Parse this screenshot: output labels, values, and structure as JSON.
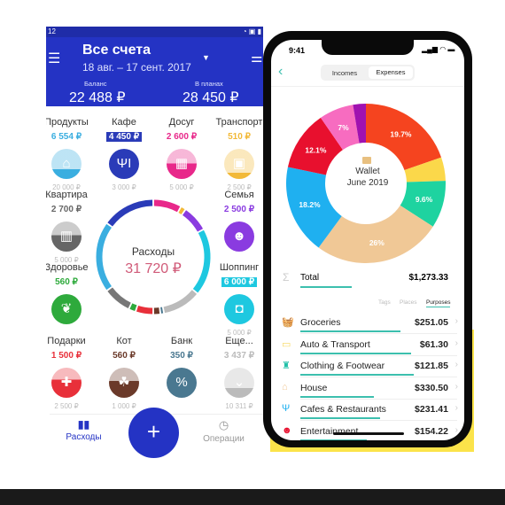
{
  "left_app": {
    "status_time": "12",
    "header": {
      "title": "Все счета",
      "period": "18 авг. – 17 сент. 2017",
      "balance_label": "Баланс",
      "balance": "22 488 ₽",
      "planned_label": "В планах",
      "planned": "28 450 ₽"
    },
    "categories": [
      {
        "label": "Продукты",
        "amount": "6 554 ₽",
        "limit": "20 000 ₽",
        "color": "#3aaee0",
        "icon": "basket-icon",
        "fill": 0.33
      },
      {
        "label": "Кафе",
        "amount": "4 450 ₽",
        "limit": "3 000 ₽",
        "color": "#2a3bb8",
        "icon": "fork-knife-icon",
        "fill": 1,
        "boxed": true
      },
      {
        "label": "Досуг",
        "amount": "2 600 ₽",
        "limit": "5 000 ₽",
        "color": "#e8288a",
        "icon": "film-icon",
        "fill": 0.52
      },
      {
        "label": "Транспорт",
        "amount": "510 ₽",
        "limit": "2 500 ₽",
        "color": "#f2b938",
        "icon": "bus-icon",
        "fill": 0.2
      },
      {
        "label": "Квартира",
        "amount": "2 700 ₽",
        "limit": "5 000 ₽",
        "color": "#666666",
        "icon": "building-icon",
        "fill": 0.54
      },
      {
        "label": "Семья",
        "amount": "2 500 ₽",
        "limit": "",
        "color": "#8a3be0",
        "icon": "face-icon",
        "fill": 1
      },
      {
        "label": "Здоровье",
        "amount": "560 ₽",
        "limit": "",
        "color": "#2eaa3c",
        "icon": "leaf-icon",
        "fill": 1
      },
      {
        "label": "Шоппинг",
        "amount": "6 000 ₽",
        "limit": "5 000 ₽",
        "color": "#1ec8e0",
        "icon": "bag-icon",
        "fill": 1,
        "boxed": true
      },
      {
        "label": "Подарки",
        "amount": "1 500 ₽",
        "limit": "2 500 ₽",
        "color": "#e8303a",
        "icon": "gift-icon",
        "fill": 0.6
      },
      {
        "label": "Кот",
        "amount": "560 ₽",
        "limit": "1 000 ₽",
        "color": "#6b3a2a",
        "icon": "paw-icon",
        "fill": 0.56
      },
      {
        "label": "Банк",
        "amount": "350 ₽",
        "limit": "",
        "color": "#4a7890",
        "icon": "percent-icon",
        "fill": 1
      },
      {
        "label": "Еще...",
        "amount": "3 437 ₽",
        "limit": "10 311 ₽",
        "color": "#bbbbbb",
        "icon": "chevron-down-icon",
        "fill": 0.33
      }
    ],
    "ring": {
      "label": "Расходы",
      "total": "31 720 ₽",
      "segments": [
        {
          "color": "#e8288a",
          "value": 8
        },
        {
          "color": "#f2b938",
          "value": 1.5
        },
        {
          "color": "#8a3be0",
          "value": 7.5
        },
        {
          "color": "#1ec8e0",
          "value": 19
        },
        {
          "color": "#bbbbbb",
          "value": 11
        },
        {
          "color": "#4a7890",
          "value": 1
        },
        {
          "color": "#6b3a2a",
          "value": 2
        },
        {
          "color": "#e8303a",
          "value": 5
        },
        {
          "color": "#2eaa3c",
          "value": 2
        },
        {
          "color": "#777777",
          "value": 8
        },
        {
          "color": "#3aaee0",
          "value": 20
        },
        {
          "color": "#2a3bb8",
          "value": 15
        }
      ]
    },
    "nav": {
      "expenses": "Расходы",
      "operations": "Операции",
      "add": "+"
    }
  },
  "right_app": {
    "status_time": "9:41",
    "tabs": [
      "Incomes",
      "Expenses"
    ],
    "active_tab": "Expenses",
    "center_title": "Wallet",
    "center_period": "June 2019",
    "donut": [
      {
        "label": "19.7%",
        "value": 19.7,
        "color": "#f5441f"
      },
      {
        "label": "",
        "value": 4.8,
        "color": "#fbd84a"
      },
      {
        "label": "9.6%",
        "value": 9.6,
        "color": "#1ed3a0"
      },
      {
        "label": "26%",
        "value": 26,
        "color": "#f0c896"
      },
      {
        "label": "18.2%",
        "value": 18.2,
        "color": "#1fb0f0"
      },
      {
        "label": "12.1%",
        "value": 12.1,
        "color": "#e8102e"
      },
      {
        "label": "7%",
        "value": 7,
        "color": "#f76cc0"
      },
      {
        "label": "",
        "value": 2.6,
        "color": "#a012b0"
      }
    ],
    "total_label": "Total",
    "total_value": "$1,273.33",
    "filters": [
      "Tags",
      "Places",
      "Purposes"
    ],
    "active_filter": "Purposes",
    "items": [
      {
        "name": "Groceries",
        "value": "$251.05",
        "icon": "basket-icon",
        "color": "#e8503a",
        "bar": 0.75
      },
      {
        "name": "Auto & Transport",
        "value": "$61.30",
        "icon": "car-icon",
        "color": "#f7d860",
        "bar": 0.83
      },
      {
        "name": "Clothing & Footwear",
        "value": "$121.85",
        "icon": "clothing-icon",
        "color": "#20c0a8",
        "bar": 0.85
      },
      {
        "name": "House",
        "value": "$330.50",
        "icon": "house-icon",
        "color": "#f0c896",
        "bar": 0.55
      },
      {
        "name": "Cafes & Restaurants",
        "value": "$231.41",
        "icon": "fork-knife-icon",
        "color": "#1fb0f0",
        "bar": 0.6
      },
      {
        "name": "Entertainment",
        "value": "$154.22",
        "icon": "mask-icon",
        "color": "#e8102e",
        "bar": 0.5
      }
    ]
  }
}
